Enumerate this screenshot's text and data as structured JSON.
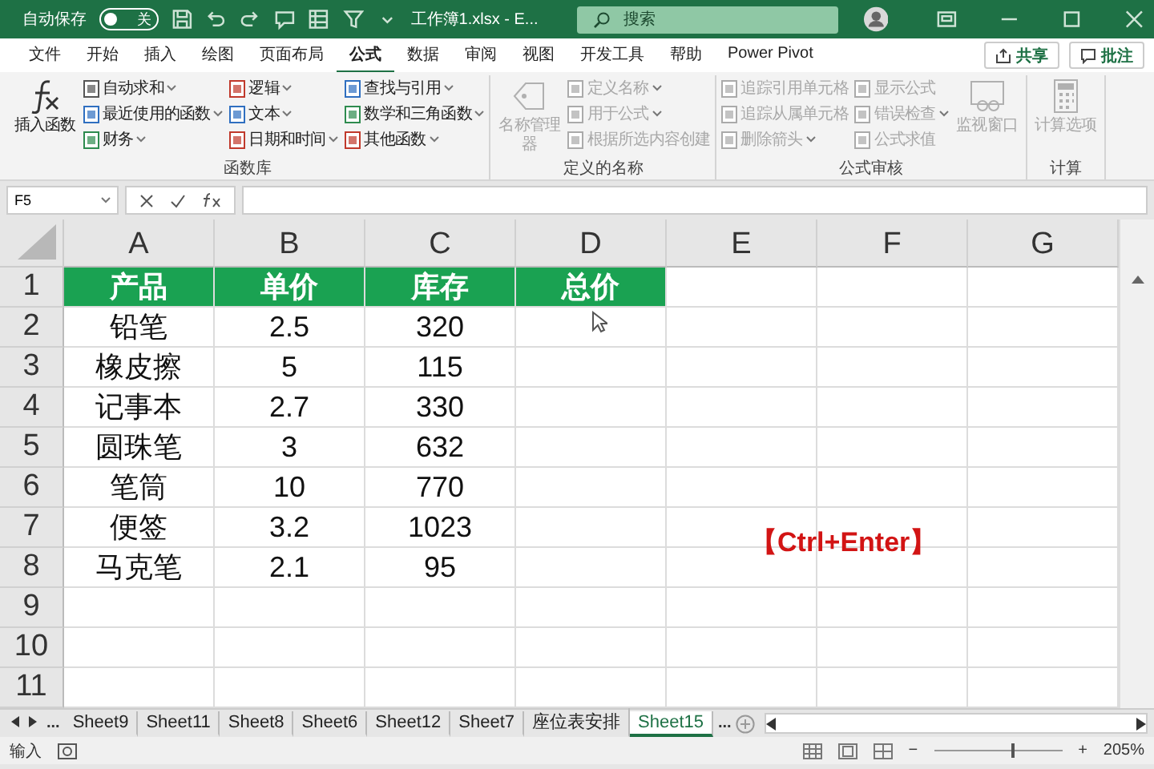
{
  "title_bar": {
    "autosave_label": "自动保存",
    "autosave_on": false,
    "autosave_state": "关",
    "filename": "工作簿1.xlsx  -  E...",
    "search_placeholder": "搜索"
  },
  "menu": {
    "tabs": [
      {
        "label": "文件",
        "selected": false
      },
      {
        "label": "开始",
        "selected": false
      },
      {
        "label": "插入",
        "selected": false
      },
      {
        "label": "绘图",
        "selected": false
      },
      {
        "label": "页面布局",
        "selected": false
      },
      {
        "label": "公式",
        "selected": true
      },
      {
        "label": "数据",
        "selected": false
      },
      {
        "label": "审阅",
        "selected": false
      },
      {
        "label": "视图",
        "selected": false
      },
      {
        "label": "开发工具",
        "selected": false
      },
      {
        "label": "帮助",
        "selected": false
      },
      {
        "label": "Power Pivot",
        "selected": false
      }
    ],
    "buttons": [
      {
        "kind": "share",
        "label": "共享"
      },
      {
        "kind": "comment",
        "label": "批注"
      }
    ]
  },
  "ribbon": {
    "groups": [
      {
        "label": "函数库",
        "large": [
          {
            "label": "插入函数",
            "kind": "fx",
            "disabled": false
          }
        ],
        "items": [
          {
            "label": "自动求和",
            "disabled": false,
            "dropdown": true,
            "color": "#555555"
          },
          {
            "label": "最近使用的函数",
            "disabled": false,
            "dropdown": true,
            "color": "#2f6fc0"
          },
          {
            "label": "财务",
            "disabled": false,
            "dropdown": true,
            "color": "#2e8b4f"
          },
          {
            "label": "逻辑",
            "disabled": false,
            "dropdown": true,
            "color": "#c0392b"
          },
          {
            "label": "文本",
            "disabled": false,
            "dropdown": true,
            "color": "#2f6fc0"
          },
          {
            "label": "日期和时间",
            "disabled": false,
            "dropdown": true,
            "color": "#c0392b"
          },
          {
            "label": "查找与引用",
            "disabled": false,
            "dropdown": true,
            "color": "#2f6fc0"
          },
          {
            "label": "数学和三角函数",
            "disabled": false,
            "dropdown": true,
            "color": "#2e8b4f"
          },
          {
            "label": "其他函数",
            "disabled": false,
            "dropdown": true,
            "color": "#c0392b"
          }
        ]
      },
      {
        "label": "定义的名称",
        "large": [
          {
            "label": "名称管理器",
            "kind": "tag",
            "disabled": true
          }
        ],
        "items": [
          {
            "label": "定义名称",
            "disabled": true,
            "dropdown": true,
            "color": "#aaaaaa"
          },
          {
            "label": "用于公式",
            "disabled": true,
            "dropdown": true,
            "color": "#aaaaaa"
          },
          {
            "label": "根据所选内容创建",
            "disabled": true,
            "dropdown": false,
            "color": "#aaaaaa"
          }
        ]
      },
      {
        "label": "公式审核",
        "items": [
          {
            "label": "追踪引用单元格",
            "disabled": true,
            "dropdown": false,
            "color": "#aaaaaa"
          },
          {
            "label": "追踪从属单元格",
            "disabled": true,
            "dropdown": false,
            "color": "#aaaaaa"
          },
          {
            "label": "删除箭头",
            "disabled": true,
            "dropdown": true,
            "color": "#aaaaaa"
          },
          {
            "label": "显示公式",
            "disabled": true,
            "dropdown": false,
            "color": "#aaaaaa"
          },
          {
            "label": "错误检查",
            "disabled": true,
            "dropdown": true,
            "color": "#aaaaaa"
          },
          {
            "label": "公式求值",
            "disabled": true,
            "dropdown": false,
            "color": "#aaaaaa"
          }
        ],
        "trailing": [
          {
            "label": "监视窗口",
            "kind": "window",
            "disabled": true
          }
        ]
      },
      {
        "label": "计算",
        "large": [
          {
            "label": "计算选项",
            "kind": "calc",
            "disabled": true
          }
        ]
      }
    ]
  },
  "formula_bar": {
    "name_box": "F5"
  },
  "grid": {
    "columns": [
      "A",
      "B",
      "C",
      "D",
      "E",
      "F",
      "G"
    ],
    "rows": [
      {
        "number": "1",
        "header": true,
        "cells": [
          "产品",
          "单价",
          "库存",
          "总价",
          "",
          "",
          ""
        ]
      },
      {
        "number": "2",
        "header": false,
        "cells": [
          "铅笔",
          "2.5",
          "320",
          "",
          "",
          "",
          ""
        ]
      },
      {
        "number": "3",
        "header": false,
        "cells": [
          "橡皮擦",
          "5",
          "115",
          "",
          "",
          "",
          ""
        ]
      },
      {
        "number": "4",
        "header": false,
        "cells": [
          "记事本",
          "2.7",
          "330",
          "",
          "",
          "",
          ""
        ]
      },
      {
        "number": "5",
        "header": false,
        "cells": [
          "圆珠笔",
          "3",
          "632",
          "",
          "",
          "",
          ""
        ]
      },
      {
        "number": "6",
        "header": false,
        "cells": [
          "笔筒",
          "10",
          "770",
          "",
          "",
          "",
          ""
        ]
      },
      {
        "number": "7",
        "header": false,
        "cells": [
          "便签",
          "3.2",
          "1023",
          "",
          "",
          "",
          ""
        ]
      },
      {
        "number": "8",
        "header": false,
        "cells": [
          "马克笔",
          "2.1",
          "95",
          "",
          "",
          "",
          ""
        ]
      },
      {
        "number": "9",
        "header": false,
        "cells": [
          "",
          "",
          "",
          "",
          "",
          "",
          ""
        ]
      },
      {
        "number": "10",
        "header": false,
        "cells": [
          "",
          "",
          "",
          "",
          "",
          "",
          ""
        ]
      },
      {
        "number": "11",
        "header": false,
        "cells": [
          "",
          "",
          "",
          "",
          "",
          "",
          ""
        ]
      }
    ],
    "annotation": "【Ctrl+Enter】"
  },
  "sheet_tabs": {
    "more_left": "...",
    "tabs": [
      {
        "label": "Sheet9",
        "selected": false
      },
      {
        "label": "Sheet11",
        "selected": false
      },
      {
        "label": "Sheet8",
        "selected": false
      },
      {
        "label": "Sheet6",
        "selected": false
      },
      {
        "label": "Sheet12",
        "selected": false
      },
      {
        "label": "Sheet7",
        "selected": false
      },
      {
        "label": "座位表安排",
        "selected": false
      },
      {
        "label": "Sheet15",
        "selected": true
      }
    ],
    "more_right": "..."
  },
  "status_bar": {
    "mode": "输入",
    "zoom_out": "−",
    "zoom_in": "+",
    "zoom": "205%",
    "zoom_slider": {
      "level": 0.6
    }
  }
}
